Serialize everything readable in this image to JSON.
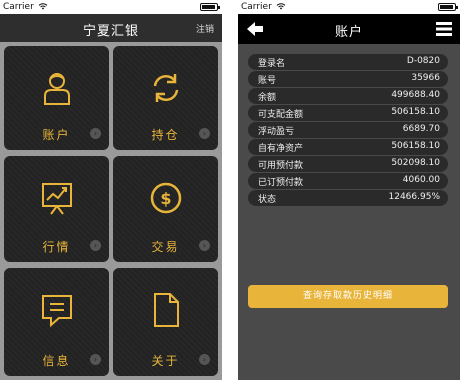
{
  "left": {
    "status": {
      "carrier": "Carrier",
      "time": "",
      "wifi_icon": "wifi-icon",
      "battery_icon": "battery-icon"
    },
    "nav": {
      "title": "宁夏汇银",
      "logout": "注销"
    },
    "tiles": [
      {
        "label": "账户",
        "icon": "person-icon"
      },
      {
        "label": "持仓",
        "icon": "refresh-icon"
      },
      {
        "label": "行情",
        "icon": "chart-board-icon"
      },
      {
        "label": "交易",
        "icon": "dollar-coin-icon"
      },
      {
        "label": "信息",
        "icon": "message-icon"
      },
      {
        "label": "关于",
        "icon": "document-icon"
      }
    ],
    "colors": {
      "accent": "#e8b53a",
      "tile": "#232323",
      "nav": "#2e2e2e",
      "grid": "#9a9a9a"
    }
  },
  "right": {
    "status": {
      "carrier": "Carrier",
      "time": "",
      "wifi_icon": "wifi-icon",
      "battery_icon": "battery-icon"
    },
    "nav": {
      "title": "账户",
      "back_icon": "back-arrow-icon",
      "menu_icon": "hamburger-menu-icon"
    },
    "rows": [
      {
        "key": "登录名",
        "value": "D-0820"
      },
      {
        "key": "账号",
        "value": "35966"
      },
      {
        "key": "余额",
        "value": "499688.40"
      },
      {
        "key": "可支配金额",
        "value": "506158.10"
      },
      {
        "key": "浮动盈亏",
        "value": "6689.70"
      },
      {
        "key": "自有净资产",
        "value": "506158.10"
      },
      {
        "key": "可用预付款",
        "value": "502098.10"
      },
      {
        "key": "已订预付款",
        "value": "4060.00"
      },
      {
        "key": "状态",
        "value": "12466.95%"
      }
    ],
    "history_button": "查询存取款历史明细",
    "colors": {
      "accent": "#e8b53a",
      "background": "#4a4a4a",
      "row": "#2a2a2a",
      "nav": "#000000"
    }
  }
}
